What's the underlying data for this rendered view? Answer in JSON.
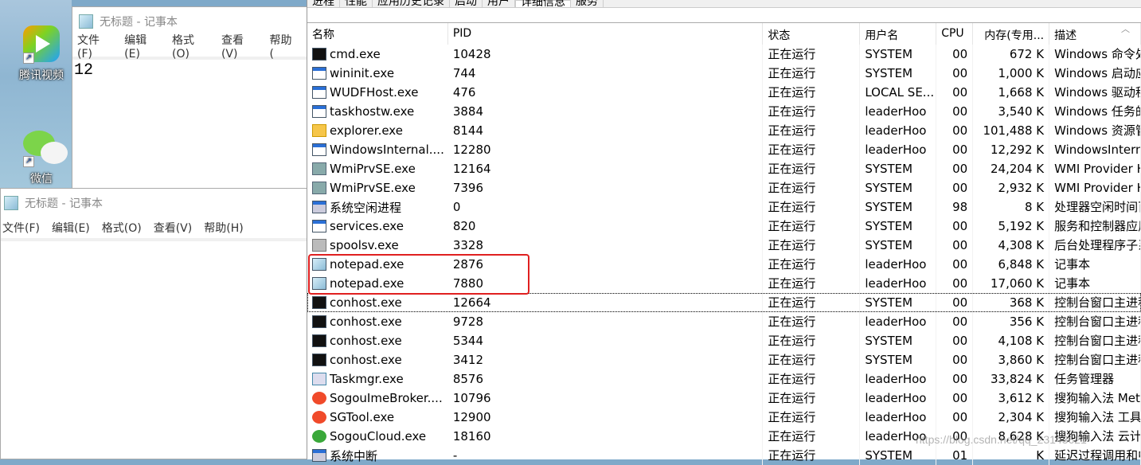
{
  "desktop": {
    "icons": [
      {
        "label": "腾讯视频",
        "icon": "tencent-video-icon"
      },
      {
        "label": "微信",
        "icon": "wechat-icon"
      }
    ]
  },
  "notepad1": {
    "title": "无标题 - 记事本",
    "menu": [
      "文件(F)",
      "编辑(E)",
      "格式(O)",
      "查看(V)",
      "帮助("
    ],
    "content": "12"
  },
  "notepad2": {
    "title": "无标题 - 记事本",
    "menu": [
      "文件(F)",
      "编辑(E)",
      "格式(O)",
      "查看(V)",
      "帮助(H)"
    ],
    "content": ""
  },
  "taskmgr": {
    "tabs": [
      "进程",
      "性能",
      "应用历史记录",
      "启动",
      "用户",
      "详细信息",
      "服务"
    ],
    "active_tab": "详细信息",
    "columns": [
      "名称",
      "PID",
      "状态",
      "用户名",
      "CPU",
      "内存(专用...",
      "描述"
    ],
    "rows": [
      {
        "name": "cmd.exe",
        "pid": "10428",
        "status": "正在运行",
        "user": "SYSTEM",
        "cpu": "00",
        "mem": "672 K",
        "desc": "Windows 命令处",
        "icon": "console-icon"
      },
      {
        "name": "wininit.exe",
        "pid": "744",
        "status": "正在运行",
        "user": "SYSTEM",
        "cpu": "00",
        "mem": "1,000 K",
        "desc": "Windows 启动应",
        "icon": "window-icon"
      },
      {
        "name": "WUDFHost.exe",
        "pid": "476",
        "status": "正在运行",
        "user": "LOCAL SE...",
        "cpu": "00",
        "mem": "1,668 K",
        "desc": "Windows 驱动程",
        "icon": "window-icon"
      },
      {
        "name": "taskhostw.exe",
        "pid": "3884",
        "status": "正在运行",
        "user": "leaderHoo",
        "cpu": "00",
        "mem": "3,540 K",
        "desc": "Windows 任务的",
        "icon": "window-icon"
      },
      {
        "name": "explorer.exe",
        "pid": "8144",
        "status": "正在运行",
        "user": "leaderHoo",
        "cpu": "00",
        "mem": "101,488 K",
        "desc": "Windows 资源管",
        "icon": "folder-icon"
      },
      {
        "name": "WindowsInternal....",
        "pid": "12280",
        "status": "正在运行",
        "user": "leaderHoo",
        "cpu": "00",
        "mem": "12,292 K",
        "desc": "WindowsIntern",
        "icon": "window-icon"
      },
      {
        "name": "WmiPrvSE.exe",
        "pid": "12164",
        "status": "正在运行",
        "user": "SYSTEM",
        "cpu": "00",
        "mem": "24,204 K",
        "desc": "WMI Provider H",
        "icon": "wmi-icon"
      },
      {
        "name": "WmiPrvSE.exe",
        "pid": "7396",
        "status": "正在运行",
        "user": "SYSTEM",
        "cpu": "00",
        "mem": "2,932 K",
        "desc": "WMI Provider H",
        "icon": "wmi-icon"
      },
      {
        "name": "系统空闲进程",
        "pid": "0",
        "status": "正在运行",
        "user": "SYSTEM",
        "cpu": "98",
        "mem": "8 K",
        "desc": "处理器空闲时间百",
        "icon": "system-icon"
      },
      {
        "name": "services.exe",
        "pid": "820",
        "status": "正在运行",
        "user": "SYSTEM",
        "cpu": "00",
        "mem": "5,192 K",
        "desc": "服务和控制器应用",
        "icon": "window-icon"
      },
      {
        "name": "spoolsv.exe",
        "pid": "3328",
        "status": "正在运行",
        "user": "SYSTEM",
        "cpu": "00",
        "mem": "4,308 K",
        "desc": "后台处理程序子系",
        "icon": "printer-icon"
      },
      {
        "name": "notepad.exe",
        "pid": "2876",
        "status": "正在运行",
        "user": "leaderHoo",
        "cpu": "00",
        "mem": "6,848 K",
        "desc": "记事本",
        "icon": "notepad-icon"
      },
      {
        "name": "notepad.exe",
        "pid": "7880",
        "status": "正在运行",
        "user": "leaderHoo",
        "cpu": "00",
        "mem": "17,060 K",
        "desc": "记事本",
        "icon": "notepad-icon"
      },
      {
        "name": "conhost.exe",
        "pid": "12664",
        "status": "正在运行",
        "user": "SYSTEM",
        "cpu": "00",
        "mem": "368 K",
        "desc": "控制台窗口主进程",
        "icon": "console-icon"
      },
      {
        "name": "conhost.exe",
        "pid": "9728",
        "status": "正在运行",
        "user": "leaderHoo",
        "cpu": "00",
        "mem": "356 K",
        "desc": "控制台窗口主进程",
        "icon": "console-icon"
      },
      {
        "name": "conhost.exe",
        "pid": "5344",
        "status": "正在运行",
        "user": "SYSTEM",
        "cpu": "00",
        "mem": "4,108 K",
        "desc": "控制台窗口主进程",
        "icon": "console-icon"
      },
      {
        "name": "conhost.exe",
        "pid": "3412",
        "status": "正在运行",
        "user": "SYSTEM",
        "cpu": "00",
        "mem": "3,860 K",
        "desc": "控制台窗口主进程",
        "icon": "console-icon"
      },
      {
        "name": "Taskmgr.exe",
        "pid": "8576",
        "status": "正在运行",
        "user": "leaderHoo",
        "cpu": "00",
        "mem": "33,824 K",
        "desc": "任务管理器",
        "icon": "taskmgr-icon"
      },
      {
        "name": "SogouImeBroker....",
        "pid": "10796",
        "status": "正在运行",
        "user": "leaderHoo",
        "cpu": "00",
        "mem": "3,612 K",
        "desc": "搜狗输入法 Met",
        "icon": "sogou-icon"
      },
      {
        "name": "SGTool.exe",
        "pid": "12900",
        "status": "正在运行",
        "user": "leaderHoo",
        "cpu": "00",
        "mem": "2,304 K",
        "desc": "搜狗输入法 工具",
        "icon": "sogou-icon"
      },
      {
        "name": "SogouCloud.exe",
        "pid": "18160",
        "status": "正在运行",
        "user": "leaderHoo",
        "cpu": "00",
        "mem": "8,628 K",
        "desc": "搜狗输入法 云计",
        "icon": "sogou-cloud-icon"
      },
      {
        "name": "系统中断",
        "pid": "-",
        "status": "正在运行",
        "user": "SYSTEM",
        "cpu": "01",
        "mem": "K",
        "desc": "延迟过程调用和中",
        "icon": "system-icon"
      }
    ]
  },
  "watermark": "https://blog.csdn.net/qq_23143621",
  "colors": {
    "highlight": "#e02020"
  }
}
